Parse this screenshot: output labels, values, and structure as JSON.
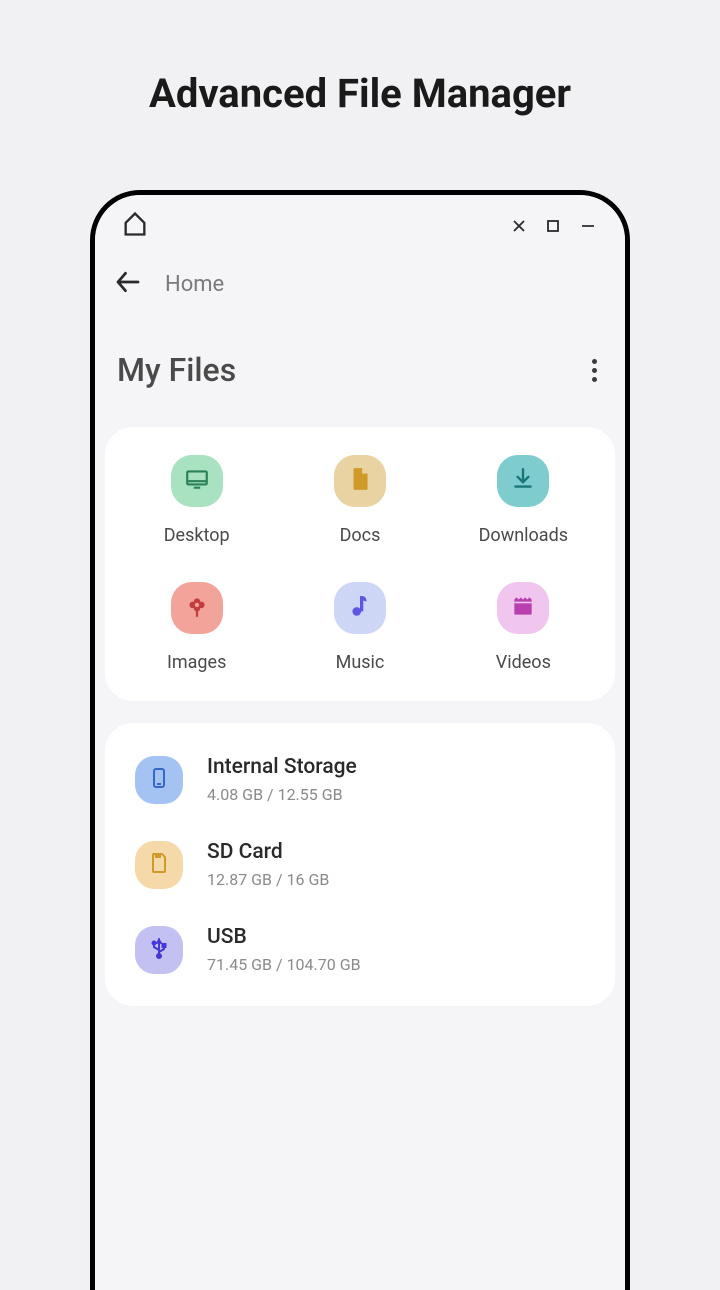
{
  "page": {
    "title": "Advanced File Manager"
  },
  "nav": {
    "breadcrumb": "Home"
  },
  "section": {
    "title": "My Files"
  },
  "categories": [
    {
      "label": "Desktop"
    },
    {
      "label": "Docs"
    },
    {
      "label": "Downloads"
    },
    {
      "label": "Images"
    },
    {
      "label": "Music"
    },
    {
      "label": "Videos"
    }
  ],
  "storage": [
    {
      "title": "Internal Storage",
      "sub": "4.08 GB / 12.55 GB"
    },
    {
      "title": "SD Card",
      "sub": "12.87 GB / 16 GB"
    },
    {
      "title": "USB",
      "sub": "71.45 GB / 104.70 GB"
    }
  ]
}
